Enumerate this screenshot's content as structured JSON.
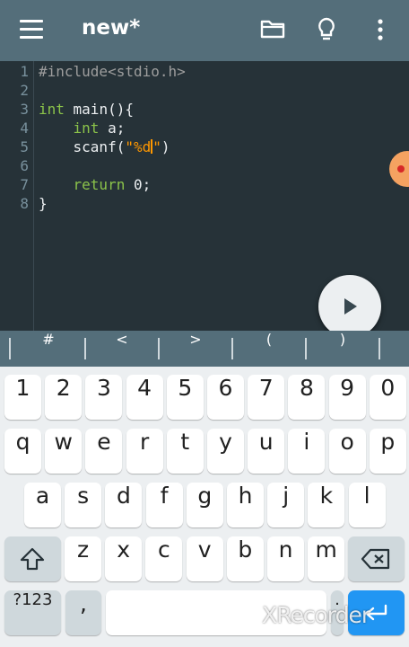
{
  "appbar": {
    "title": "new*"
  },
  "editor": {
    "line_numbers": [
      "1",
      "2",
      "3",
      "4",
      "5",
      "6",
      "7",
      "8"
    ],
    "lines": [
      {
        "parts": [
          {
            "cls": "kw-pre",
            "t": "#include<stdio.h>"
          }
        ]
      },
      {
        "parts": []
      },
      {
        "parts": [
          {
            "cls": "kw",
            "t": "int"
          },
          {
            "cls": "",
            "t": " main(){"
          }
        ]
      },
      {
        "parts": [
          {
            "cls": "",
            "t": "    "
          },
          {
            "cls": "kw",
            "t": "int"
          },
          {
            "cls": "",
            "t": " a;"
          }
        ]
      },
      {
        "parts": [
          {
            "cls": "",
            "t": "    scanf("
          },
          {
            "cls": "str",
            "t": "\"%d"
          },
          {
            "cls": "cursor",
            "t": ""
          },
          {
            "cls": "str",
            "t": "\""
          },
          {
            "cls": "",
            "t": ")"
          }
        ]
      },
      {
        "parts": []
      },
      {
        "parts": [
          {
            "cls": "",
            "t": "    "
          },
          {
            "cls": "kw",
            "t": "return"
          },
          {
            "cls": "",
            "t": " 0;"
          }
        ]
      },
      {
        "parts": [
          {
            "cls": "",
            "t": "}"
          }
        ]
      }
    ]
  },
  "symbols": [
    "#",
    "<",
    ">",
    "(",
    ")"
  ],
  "keyboard": {
    "row1": [
      "1",
      "2",
      "3",
      "4",
      "5",
      "6",
      "7",
      "8",
      "9",
      "0"
    ],
    "row2": [
      "q",
      "w",
      "e",
      "r",
      "t",
      "y",
      "u",
      "i",
      "o",
      "p"
    ],
    "row3": [
      "a",
      "s",
      "d",
      "f",
      "g",
      "h",
      "j",
      "k",
      "l"
    ],
    "row4": [
      "z",
      "x",
      "c",
      "v",
      "b",
      "n",
      "m"
    ],
    "symbols_key": "?123",
    "comma_key": ",",
    "period_key": "."
  },
  "watermark": "XRecorder",
  "colors": {
    "appbar": "#546e7a",
    "editor_bg": "#263238",
    "keyword": "#8bc34a",
    "string": "#ff9800",
    "enter": "#2196f3"
  }
}
